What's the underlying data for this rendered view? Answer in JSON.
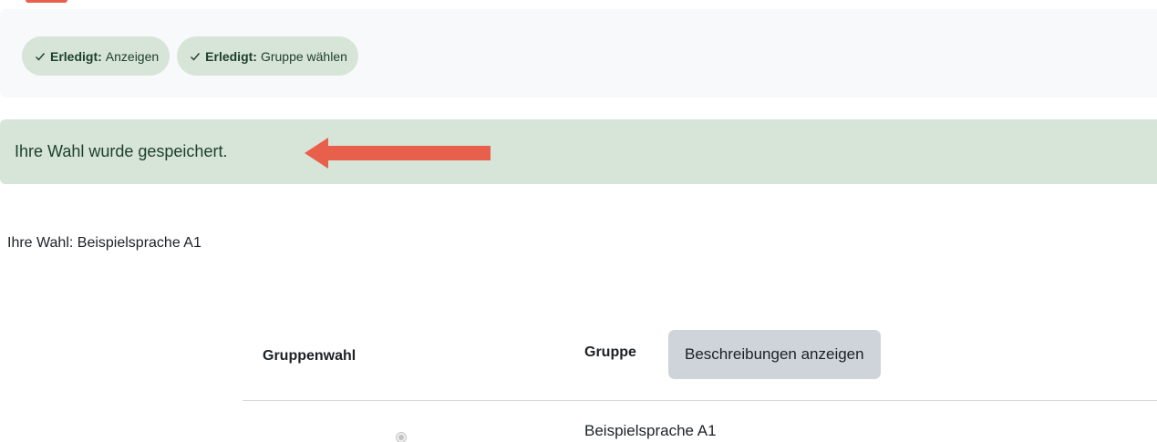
{
  "completion": {
    "badges": [
      {
        "status": "Erledigt:",
        "label": "Anzeigen"
      },
      {
        "status": "Erledigt:",
        "label": "Gruppe wählen"
      }
    ]
  },
  "alert": {
    "message": "Ihre Wahl wurde gespeichert."
  },
  "annotation": {
    "arrow_color": "#e8604c",
    "arrow_icon": "left-arrow-icon"
  },
  "choice": {
    "summary": "Ihre Wahl: Beispielsprache A1"
  },
  "table": {
    "headers": {
      "choice": "Gruppenwahl",
      "group": "Gruppe"
    },
    "show_descriptions_label": "Beschreibungen anzeigen",
    "rows": [
      {
        "group": "Beispielsprache A1",
        "selected": true,
        "disabled": true
      }
    ]
  },
  "colors": {
    "success_bg": "#d7e4d8",
    "success_text": "#1c3f2a",
    "button_bg": "#ced4da",
    "panel_bg": "#f8f9fa"
  }
}
